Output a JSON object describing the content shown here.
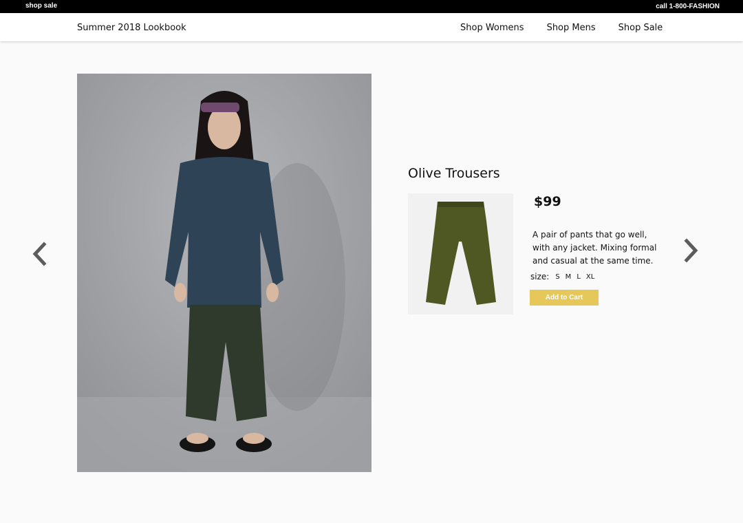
{
  "topbar": {
    "left_link": "shop sale",
    "phone": "call 1-800-FASHION"
  },
  "nav": {
    "brand": "Summer 2018 Lookbook",
    "links": [
      {
        "label": "Shop Womens"
      },
      {
        "label": "Shop Mens"
      },
      {
        "label": "Shop Sale"
      }
    ]
  },
  "icons": {
    "prev": "chevron-left-icon",
    "next": "chevron-right-icon"
  },
  "product": {
    "title": "Olive Trousers",
    "price": "$99",
    "description": "A pair of pants that go well, with any jacket. Mixing formal and casual at the same time.",
    "size_label": "size:",
    "sizes": [
      "S",
      "M",
      "L",
      "XL"
    ],
    "add_to_cart": "Add to Cart",
    "accent_color": "#e6c85a"
  },
  "colors": {
    "topbar_bg": "#000000",
    "page_bg": "#fafafa",
    "arrow": "#5c5c5c"
  }
}
